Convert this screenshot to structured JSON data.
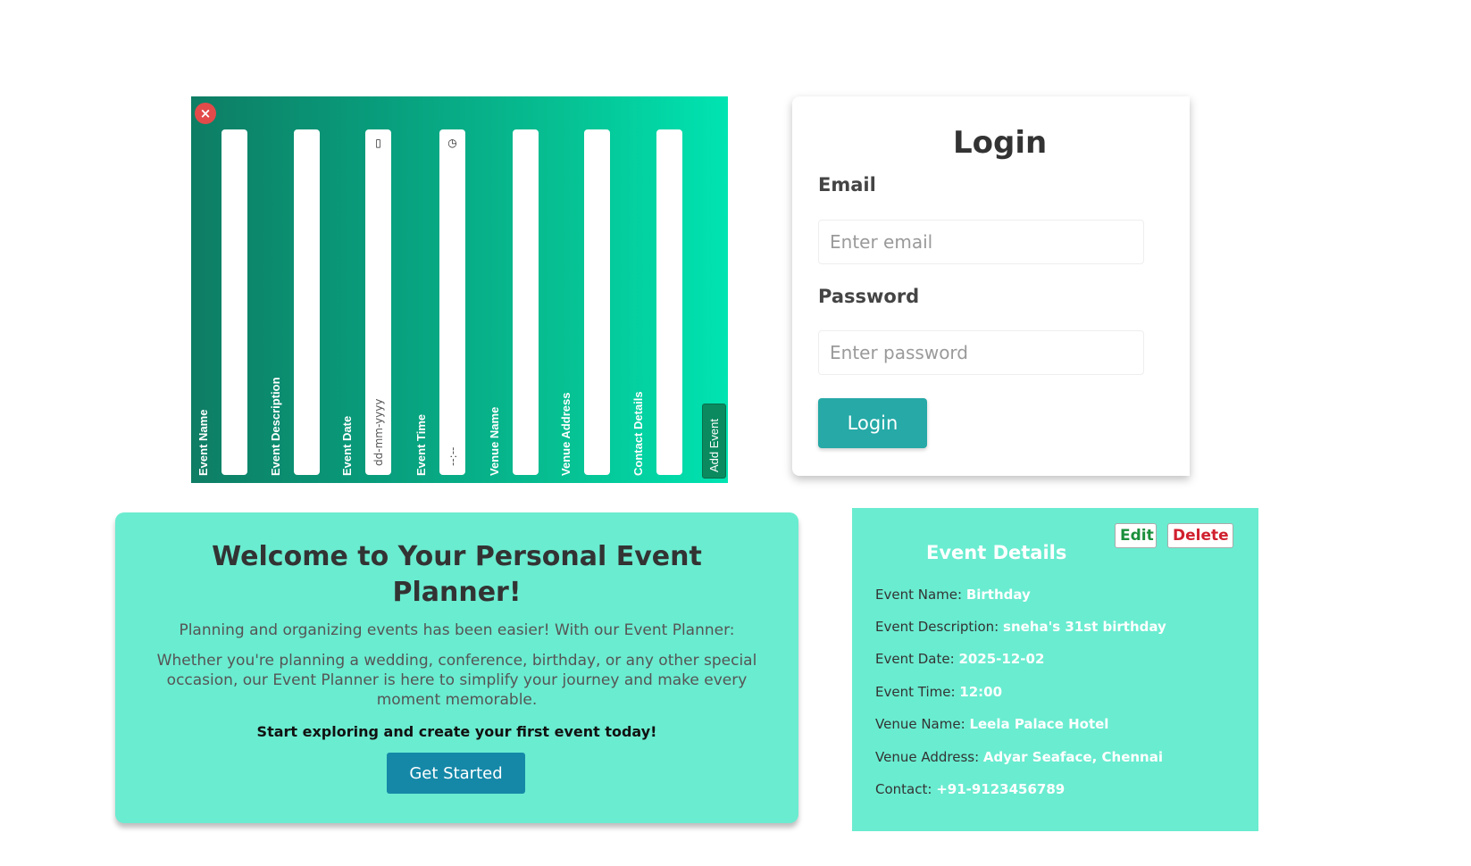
{
  "add_event_form": {
    "close_icon": "×",
    "fields": [
      {
        "label": "Event Name",
        "placeholder": "",
        "icon": ""
      },
      {
        "label": "Event Description",
        "placeholder": "",
        "icon": ""
      },
      {
        "label": "Event Date",
        "placeholder": "dd-mm-yyyy",
        "icon": "calendar-icon"
      },
      {
        "label": "Event Time",
        "placeholder": "--:--",
        "icon": "clock-icon"
      },
      {
        "label": "Venue Name",
        "placeholder": "",
        "icon": ""
      },
      {
        "label": "Venue Address",
        "placeholder": "",
        "icon": ""
      },
      {
        "label": "Contact Details",
        "placeholder": "",
        "icon": ""
      }
    ],
    "submit_label": "Add Event"
  },
  "login": {
    "title": "Login",
    "email_label": "Email",
    "email_placeholder": "Enter email",
    "password_label": "Password",
    "password_placeholder": "Enter password",
    "button_label": "Login",
    "accent": "#26a9a7"
  },
  "welcome": {
    "title": "Welcome to Your Personal Event Planner!",
    "intro": "Planning and organizing events has been easier! With our Event Planner:",
    "body": "Whether you're planning a wedding, conference, birthday, or any other special occasion, our Event Planner is here to simplify your journey and make every moment memorable.",
    "cta": "Start exploring and create your first event today!",
    "button_label": "Get Started",
    "background": "#6aecd0"
  },
  "event_details": {
    "title": "Event Details",
    "edit_label": "Edit",
    "delete_label": "Delete",
    "rows": [
      {
        "key": "Event Name:",
        "value": "Birthday"
      },
      {
        "key": "Event Description:",
        "value": "sneha's 31st birthday"
      },
      {
        "key": "Event Date:",
        "value": "2025-12-02"
      },
      {
        "key": "Event Time:",
        "value": "12:00"
      },
      {
        "key": "Venue Name:",
        "value": "Leela Palace Hotel"
      },
      {
        "key": "Venue Address:",
        "value": "Adyar Seaface, Chennai"
      },
      {
        "key": "Contact:",
        "value": "+91-9123456789"
      }
    ]
  }
}
